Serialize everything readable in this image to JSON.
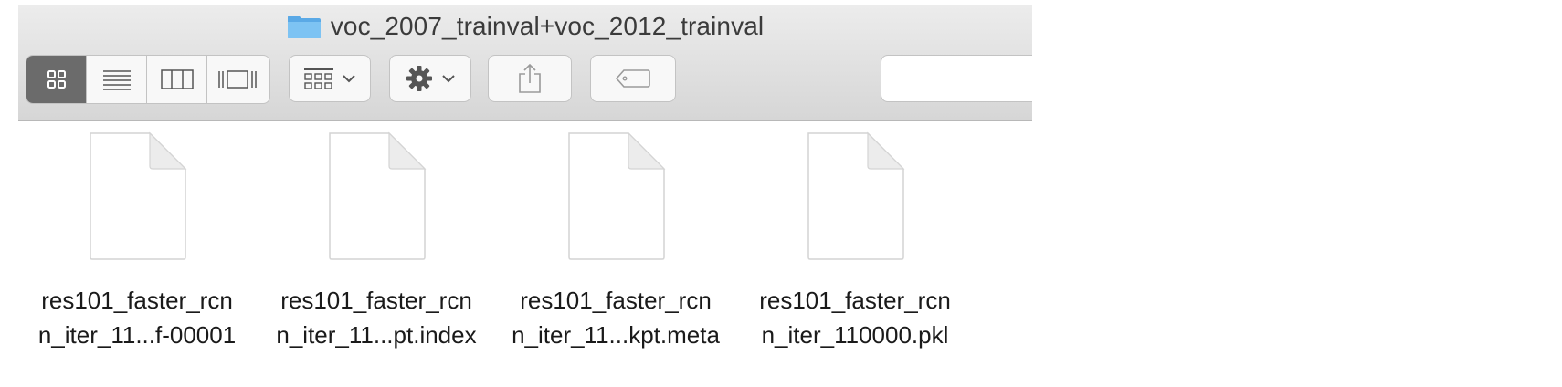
{
  "window": {
    "title": "voc_2007_trainval+voc_2012_trainval",
    "title_icon": "folder-icon"
  },
  "toolbar": {
    "view_buttons": [
      {
        "name": "icon-view",
        "icon": "grid-icon",
        "active": true
      },
      {
        "name": "list-view",
        "icon": "list-icon",
        "active": false
      },
      {
        "name": "column-view",
        "icon": "columns-icon",
        "active": false
      },
      {
        "name": "gallery-view",
        "icon": "cover-flow-icon",
        "active": false
      }
    ],
    "arrange_icon": "arrange-grid-icon",
    "action_icon": "gear-icon",
    "share_icon": "share-icon",
    "tags_icon": "tag-icon"
  },
  "files": [
    {
      "line1": "res101_faster_rcn",
      "line2": "n_iter_11...f-00001"
    },
    {
      "line1": "res101_faster_rcn",
      "line2": "n_iter_11...pt.index"
    },
    {
      "line1": "res101_faster_rcn",
      "line2": "n_iter_11...kpt.meta"
    },
    {
      "line1": "res101_faster_rcn",
      "line2": "n_iter_110000.pkl"
    }
  ],
  "colors": {
    "folder_blue": "#6cb6ee",
    "toolbar_bg": "#e2e2e2",
    "active_view": "#6b6b6b"
  }
}
